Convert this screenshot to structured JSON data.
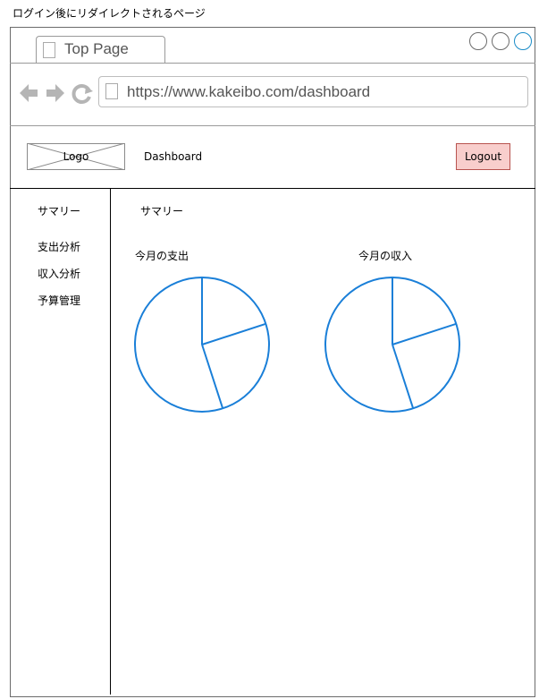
{
  "caption": "ログイン後にリダイレクトされるページ",
  "browser": {
    "tab_title": "Top Page",
    "url": "https://www.kakeibo.com/dashboard",
    "icons": [
      "back-arrow-icon",
      "forward-arrow-icon",
      "reload-icon",
      "page-icon"
    ]
  },
  "header": {
    "logo_label": "Logo",
    "nav_dashboard": "Dashboard",
    "logout_label": "Logout"
  },
  "sidebar": {
    "items": [
      {
        "label": "サマリー"
      },
      {
        "label": "支出分析"
      },
      {
        "label": "収入分析"
      },
      {
        "label": "予算管理"
      }
    ]
  },
  "main": {
    "title": "サマリー",
    "charts": [
      {
        "title": "今月の支出"
      },
      {
        "title": "今月の収入"
      }
    ]
  },
  "chart_data": [
    {
      "type": "pie",
      "title": "今月の支出",
      "values": [
        0.2,
        0.25,
        0.55
      ],
      "colors": [
        "#1a7fd8"
      ]
    },
    {
      "type": "pie",
      "title": "今月の収入",
      "values": [
        0.2,
        0.25,
        0.55
      ],
      "colors": [
        "#1a7fd8"
      ]
    }
  ]
}
